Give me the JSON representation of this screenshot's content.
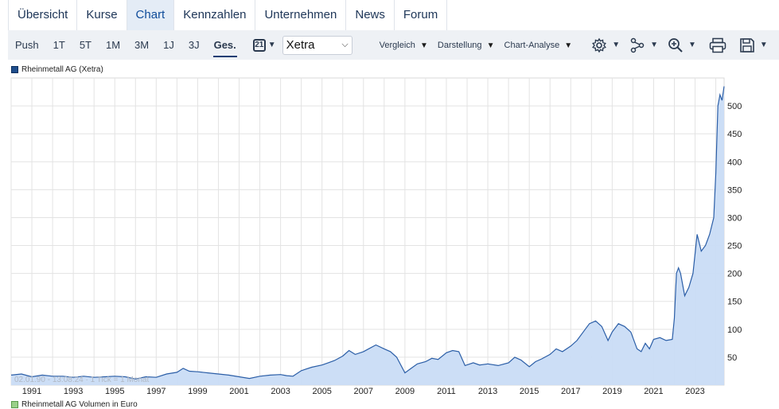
{
  "tabs": [
    {
      "label": "Übersicht"
    },
    {
      "label": "Kurse"
    },
    {
      "label": "Chart"
    },
    {
      "label": "Kennzahlen"
    },
    {
      "label": "Unternehmen"
    },
    {
      "label": "News"
    },
    {
      "label": "Forum"
    }
  ],
  "active_tab": "Chart",
  "toolbar": {
    "ranges": [
      {
        "label": "Push"
      },
      {
        "label": "1T"
      },
      {
        "label": "5T"
      },
      {
        "label": "1M"
      },
      {
        "label": "3M"
      },
      {
        "label": "1J"
      },
      {
        "label": "3J"
      },
      {
        "label": "Ges."
      }
    ],
    "active_range": "Ges.",
    "calendar_label": "21",
    "exchange_select": "Xetra",
    "menus": {
      "compare": "Vergleich",
      "display": "Darstellung",
      "analysis": "Chart-Analyse"
    },
    "icons": [
      "gear-icon",
      "network-icon",
      "zoom-in-icon",
      "print-icon",
      "save-icon"
    ]
  },
  "legend": {
    "series": "Rheinmetall AG (Xetra)",
    "volume": "Rheinmetall AG Volumen in Euro"
  },
  "watermark": "02.01.90 - 13:08:24 · 1 Tick = 1 Monat",
  "colors": {
    "line": "#2b5ea7",
    "fill": "#c9dcf6",
    "tab_active": "#e4ecf6",
    "toolbar": "#eef1f5",
    "grid": "#e3e3e3"
  },
  "chart_data": {
    "type": "area",
    "series_name": "Rheinmetall AG (Xetra)",
    "x_ticks": [
      "1991",
      "1993",
      "1995",
      "1997",
      "1999",
      "2001",
      "2003",
      "2005",
      "2007",
      "2009",
      "2011",
      "2013",
      "2015",
      "2017",
      "2019",
      "2021",
      "2023"
    ],
    "y_ticks": [
      50,
      100,
      150,
      200,
      250,
      300,
      350,
      400,
      450,
      500
    ],
    "xlim": [
      1990.0,
      2024.4
    ],
    "ylim": [
      0,
      550
    ],
    "grid": true,
    "y_axis_side": "right",
    "x": [
      1990.0,
      1990.5,
      1991.0,
      1991.5,
      1992.0,
      1992.5,
      1993.0,
      1993.5,
      1994.0,
      1994.5,
      1995.0,
      1995.5,
      1996.0,
      1996.5,
      1997.0,
      1997.5,
      1998.0,
      1998.3,
      1998.6,
      1999.0,
      1999.5,
      2000.0,
      2000.5,
      2001.0,
      2001.5,
      2002.0,
      2002.5,
      2003.0,
      2003.3,
      2003.6,
      2004.0,
      2004.5,
      2005.0,
      2005.3,
      2005.6,
      2006.0,
      2006.3,
      2006.6,
      2007.0,
      2007.3,
      2007.6,
      2008.0,
      2008.3,
      2008.6,
      2009.0,
      2009.3,
      2009.6,
      2010.0,
      2010.3,
      2010.6,
      2011.0,
      2011.3,
      2011.6,
      2011.9,
      2012.3,
      2012.6,
      2013.0,
      2013.5,
      2014.0,
      2014.3,
      2014.6,
      2015.0,
      2015.3,
      2015.6,
      2016.0,
      2016.3,
      2016.6,
      2017.0,
      2017.3,
      2017.6,
      2017.9,
      2018.2,
      2018.5,
      2018.8,
      2019.0,
      2019.3,
      2019.6,
      2019.9,
      2020.2,
      2020.4,
      2020.6,
      2020.8,
      2021.0,
      2021.3,
      2021.6,
      2021.9,
      2022.0,
      2022.1,
      2022.2,
      2022.3,
      2022.5,
      2022.7,
      2022.9,
      2023.1,
      2023.3,
      2023.5,
      2023.7,
      2023.9,
      2024.0,
      2024.1,
      2024.2,
      2024.3,
      2024.4
    ],
    "y": [
      18,
      20,
      15,
      18,
      16,
      16,
      14,
      16,
      14,
      15,
      16,
      15,
      11,
      15,
      14,
      20,
      23,
      30,
      25,
      24,
      22,
      20,
      18,
      15,
      12,
      16,
      18,
      19,
      17,
      16,
      26,
      32,
      36,
      40,
      44,
      52,
      62,
      55,
      60,
      66,
      72,
      65,
      60,
      50,
      22,
      30,
      38,
      42,
      48,
      46,
      58,
      62,
      60,
      35,
      40,
      36,
      38,
      35,
      40,
      50,
      45,
      33,
      42,
      47,
      55,
      65,
      60,
      70,
      80,
      95,
      110,
      115,
      105,
      80,
      95,
      110,
      105,
      95,
      65,
      60,
      75,
      65,
      82,
      85,
      80,
      82,
      120,
      200,
      210,
      200,
      160,
      175,
      200,
      270,
      240,
      250,
      270,
      300,
      380,
      500,
      520,
      510,
      535
    ]
  }
}
